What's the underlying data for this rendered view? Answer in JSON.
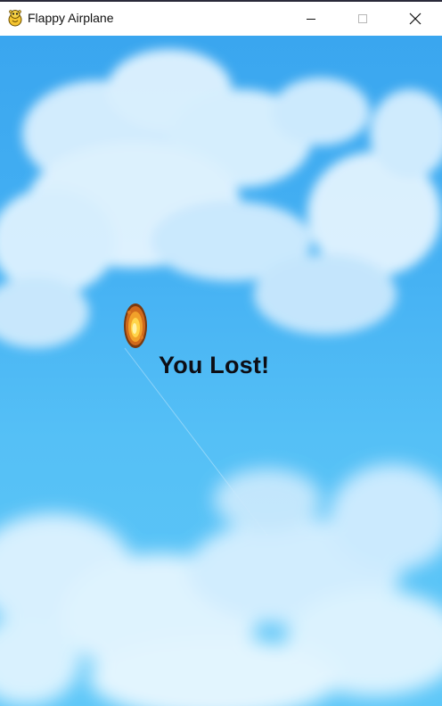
{
  "window": {
    "title": "Flappy Airplane",
    "app_icon": "pygame-snake-icon",
    "controls": {
      "minimize_icon": "minimize-icon",
      "maximize_icon": "maximize-icon",
      "close_icon": "close-icon"
    }
  },
  "game": {
    "state": "game-over",
    "status_text": "You Lost!",
    "player_sprite": "explosion-icon",
    "background": "sky-with-clouds",
    "colors": {
      "sky_top": "#3aa6ef",
      "sky_bottom": "#5ec7f8",
      "cloud": "#e8f6ff",
      "text": "#0d0d14",
      "fire_outer": "#c0611a",
      "fire_core": "#ffe86a"
    }
  }
}
